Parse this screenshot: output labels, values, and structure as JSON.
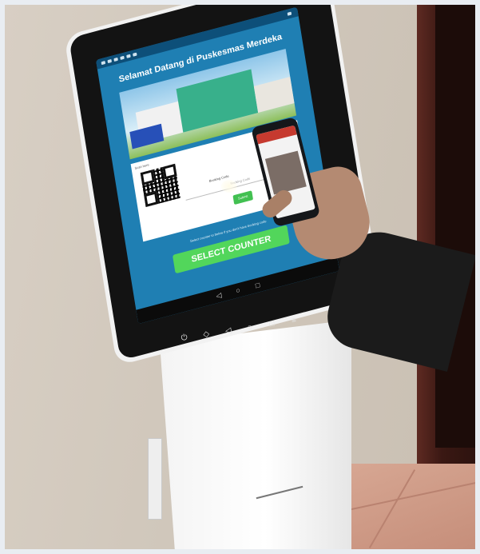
{
  "kiosk_screen": {
    "title": "Selamat Datang di Puskesmas Merdeka",
    "scan_here_label": "Scan here",
    "booking_code_label": "Booking Code",
    "booking_code_placeholder": "Booking Code",
    "submit_label": "Submit",
    "instruction_text": "Select counter to below if you don't have booking code",
    "select_counter_label": "SELECT COUNTER"
  },
  "colors": {
    "screen_bg": "#1f7fb3",
    "select_button": "#52d65b",
    "phone_header": "#c63a2f"
  },
  "icons": {
    "power": "power-icon",
    "back": "back-icon",
    "home": "home-icon",
    "recents": "recents-icon"
  }
}
